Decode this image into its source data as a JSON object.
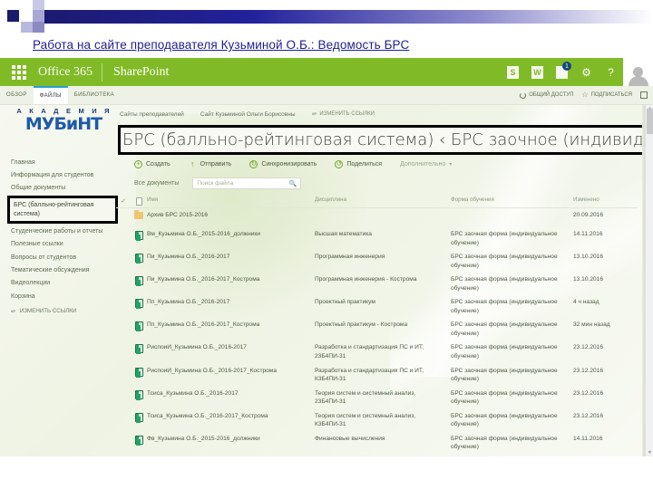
{
  "slide": {
    "heading": "Работа на сайте преподавателя Кузьминой О.Б.: Ведомость БРС"
  },
  "suitebar": {
    "waffle_icon": "app-launcher-icon",
    "office_label": "Office 365",
    "product_label": "SharePoint",
    "icons": [
      {
        "name": "skype-icon",
        "glyph": "S"
      },
      {
        "name": "word-icon",
        "glyph": "W"
      },
      {
        "name": "notifications-bell-icon",
        "glyph": "♙",
        "badge": "1"
      },
      {
        "name": "settings-gear-icon",
        "glyph": "⚙"
      },
      {
        "name": "help-icon",
        "glyph": "?"
      }
    ],
    "avatar_name": "user-avatar"
  },
  "ribbon": {
    "tabs": [
      {
        "label": "ОБЗОР",
        "active": false
      },
      {
        "label": "ФАЙЛЫ",
        "active": true
      },
      {
        "label": "БИБЛИОТЕКА",
        "active": false
      }
    ],
    "share_label": "ОБЩИЙ ДОСТУП",
    "follow_label": "ПОДПИСАТЬСЯ",
    "focus_label": "focus-on-content-icon"
  },
  "logo": {
    "top_line": "А К А Д Е М И Я",
    "main_line": "МУБиНТ"
  },
  "sitenav": {
    "links": [
      {
        "label": "Сайты преподавателей"
      },
      {
        "label": "Сайт Кузьминой Ольги Борисовны"
      }
    ],
    "edit_links_label": "ИЗМЕНИТЬ ССЫЛКИ"
  },
  "title": {
    "text": "БРС (балльно-рейтинговая система) ‹ БРС заочное (индивидуально"
  },
  "toolbar": {
    "items": [
      {
        "label": "Создать",
        "icon": "plus-circle-icon",
        "dim": false
      },
      {
        "label": "Отправить",
        "icon": "upload-icon",
        "dim": false
      },
      {
        "label": "Синхронизировать",
        "icon": "sync-icon",
        "dim": false
      },
      {
        "label": "Поделиться",
        "icon": "share-icon",
        "dim": false
      },
      {
        "label": "Дополнительно",
        "icon": "chevron-down-icon",
        "dim": true
      }
    ]
  },
  "viewrow": {
    "view_label": "Все документы",
    "search_placeholder": "Поиск файла"
  },
  "leftnav": {
    "items": [
      {
        "label": "Главная",
        "selected": false
      },
      {
        "label": "Информация для студентов",
        "selected": false
      },
      {
        "label": "Общие документы",
        "selected": false
      },
      {
        "label": "БРС (балльно-рейтинговая система)",
        "selected": true
      },
      {
        "label": "Студенческие работы и отчеты",
        "selected": false
      },
      {
        "label": "Полезные ссылки",
        "selected": false
      },
      {
        "label": "Вопросы от студентов",
        "selected": false
      },
      {
        "label": "Тематические обсуждения",
        "selected": false
      },
      {
        "label": "Видеолекции",
        "selected": false
      },
      {
        "label": "Корзина",
        "selected": false
      }
    ],
    "edit_links_label": "ИЗМЕНИТЬ ССЫЛКИ"
  },
  "table": {
    "headers": {
      "check": "✓",
      "icon": "document-type-icon",
      "name": "Имя",
      "discipline": "Дисциплина",
      "form": "Форма обучения",
      "modified": "Изменено"
    },
    "rows": [
      {
        "icon": "folder-icon",
        "name": "Архив БРС 2015-2016",
        "discipline": "",
        "form": "",
        "modified": "20.09.2016"
      },
      {
        "icon": "excel-icon",
        "name": "Вм_Кузьмина О.Б._2015-2016_должники",
        "discipline": "Высшая математика",
        "form": "БРС заочная форма (индивидуальное обучение)",
        "modified": "14.11.2016"
      },
      {
        "icon": "excel-icon",
        "name": "Пи_Кузьмина О.Б._2016-2017",
        "discipline": "Программная инженерия",
        "form": "БРС заочная форма (индивидуальное обучение)",
        "modified": "13.10.2016"
      },
      {
        "icon": "excel-icon",
        "name": "Пи_Кузьмина О.Б._2016-2017_Кострома",
        "discipline": "Программная инженерия - Кострома",
        "form": "БРС заочная форма (индивидуальное обучение)",
        "modified": "13.10.2016"
      },
      {
        "icon": "excel-icon",
        "name": "Пп_Кузьмина О.Б._2016-2017",
        "discipline": "Проектный практикум",
        "form": "БРС заочная форма (индивидуальное обучение)",
        "modified": "4 ч назад"
      },
      {
        "icon": "excel-icon",
        "name": "Пп_Кузьмина О.Б._2016-2017_Кострома",
        "discipline": "Проектный практикум - Кострома",
        "form": "БРС заочная форма (индивидуальное обучение)",
        "modified": "32 мин назад"
      },
      {
        "icon": "excel-icon",
        "name": "РиспоиИ_Кузьмина О.Б._2016-2017",
        "discipline": "Разработка и стандартизация ПС и ИТ, 23Б4ПИ-31",
        "form": "БРС заочная форма (индивидуальное обучение)",
        "modified": "23.12.2016"
      },
      {
        "icon": "excel-icon",
        "name": "РиспоиИ_Кузьмина О.Б._2016-2017_Кострома",
        "discipline": "Разработка и стандартизация ПС и ИТ, К3Б4ПИ-31",
        "form": "БРС заочная форма (индивидуальное обучение)",
        "modified": "23.12.2016"
      },
      {
        "icon": "excel-icon",
        "name": "Тсиса_Кузьмина О.Б._2016-2017",
        "discipline": "Теория систем и системный анализ, 23Б4ПИ-31",
        "form": "БРС заочная форма (индивидуальное обучение)",
        "modified": "23.12.2016"
      },
      {
        "icon": "excel-icon",
        "name": "Тсиса_Кузьмина О.Б._2016-2017_Кострома",
        "discipline": "Теория систем и системный анализ, К3Б4ПИ-31",
        "form": "БРС заочная форма (индивидуальное обучение)",
        "modified": "23.12.2016"
      },
      {
        "icon": "excel-icon",
        "name": "Фв_Кузьмина О.Б._2015-2016_должники",
        "discipline": "Финансовые вычисления",
        "form": "БРС заочная форма (индивидуальное обучение)",
        "modified": "14.11.2016"
      }
    ]
  },
  "colors": {
    "suite_green": "#80bb27",
    "heading_blue": "#1f1f8f",
    "deco_navy": "#1b1a6e",
    "excel_green": "#21a366",
    "folder_orange": "#f0c571"
  }
}
